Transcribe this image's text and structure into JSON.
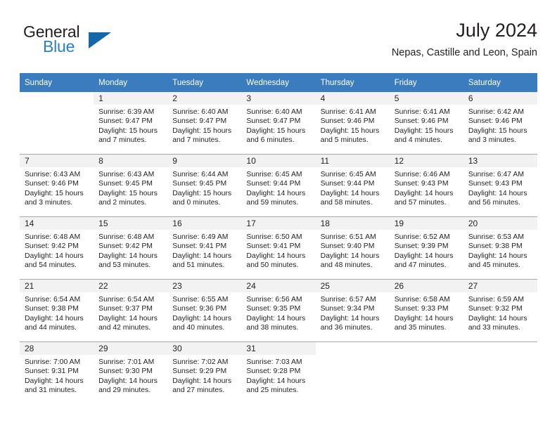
{
  "brand": {
    "name_part1": "General",
    "name_part2": "Blue",
    "triangle_color": "#1667a8",
    "blue_color": "#2980c4"
  },
  "header": {
    "title": "July 2024",
    "subtitle": "Nepas, Castille and Leon, Spain"
  },
  "theme": {
    "header_row_bg": "#3a7cbe",
    "header_row_text": "#ffffff",
    "daynum_bg": "#f2f2f2",
    "grid_line": "#a9a9a9",
    "text": "#231f20"
  },
  "weekdays": [
    "Sunday",
    "Monday",
    "Tuesday",
    "Wednesday",
    "Thursday",
    "Friday",
    "Saturday"
  ],
  "weeks": [
    [
      {
        "day": "",
        "sunrise": "",
        "sunset": "",
        "daylight1": "",
        "daylight2": ""
      },
      {
        "day": "1",
        "sunrise": "Sunrise: 6:39 AM",
        "sunset": "Sunset: 9:47 PM",
        "daylight1": "Daylight: 15 hours",
        "daylight2": "and 7 minutes."
      },
      {
        "day": "2",
        "sunrise": "Sunrise: 6:40 AM",
        "sunset": "Sunset: 9:47 PM",
        "daylight1": "Daylight: 15 hours",
        "daylight2": "and 7 minutes."
      },
      {
        "day": "3",
        "sunrise": "Sunrise: 6:40 AM",
        "sunset": "Sunset: 9:47 PM",
        "daylight1": "Daylight: 15 hours",
        "daylight2": "and 6 minutes."
      },
      {
        "day": "4",
        "sunrise": "Sunrise: 6:41 AM",
        "sunset": "Sunset: 9:46 PM",
        "daylight1": "Daylight: 15 hours",
        "daylight2": "and 5 minutes."
      },
      {
        "day": "5",
        "sunrise": "Sunrise: 6:41 AM",
        "sunset": "Sunset: 9:46 PM",
        "daylight1": "Daylight: 15 hours",
        "daylight2": "and 4 minutes."
      },
      {
        "day": "6",
        "sunrise": "Sunrise: 6:42 AM",
        "sunset": "Sunset: 9:46 PM",
        "daylight1": "Daylight: 15 hours",
        "daylight2": "and 3 minutes."
      }
    ],
    [
      {
        "day": "7",
        "sunrise": "Sunrise: 6:43 AM",
        "sunset": "Sunset: 9:46 PM",
        "daylight1": "Daylight: 15 hours",
        "daylight2": "and 3 minutes."
      },
      {
        "day": "8",
        "sunrise": "Sunrise: 6:43 AM",
        "sunset": "Sunset: 9:45 PM",
        "daylight1": "Daylight: 15 hours",
        "daylight2": "and 2 minutes."
      },
      {
        "day": "9",
        "sunrise": "Sunrise: 6:44 AM",
        "sunset": "Sunset: 9:45 PM",
        "daylight1": "Daylight: 15 hours",
        "daylight2": "and 0 minutes."
      },
      {
        "day": "10",
        "sunrise": "Sunrise: 6:45 AM",
        "sunset": "Sunset: 9:44 PM",
        "daylight1": "Daylight: 14 hours",
        "daylight2": "and 59 minutes."
      },
      {
        "day": "11",
        "sunrise": "Sunrise: 6:45 AM",
        "sunset": "Sunset: 9:44 PM",
        "daylight1": "Daylight: 14 hours",
        "daylight2": "and 58 minutes."
      },
      {
        "day": "12",
        "sunrise": "Sunrise: 6:46 AM",
        "sunset": "Sunset: 9:43 PM",
        "daylight1": "Daylight: 14 hours",
        "daylight2": "and 57 minutes."
      },
      {
        "day": "13",
        "sunrise": "Sunrise: 6:47 AM",
        "sunset": "Sunset: 9:43 PM",
        "daylight1": "Daylight: 14 hours",
        "daylight2": "and 56 minutes."
      }
    ],
    [
      {
        "day": "14",
        "sunrise": "Sunrise: 6:48 AM",
        "sunset": "Sunset: 9:42 PM",
        "daylight1": "Daylight: 14 hours",
        "daylight2": "and 54 minutes."
      },
      {
        "day": "15",
        "sunrise": "Sunrise: 6:48 AM",
        "sunset": "Sunset: 9:42 PM",
        "daylight1": "Daylight: 14 hours",
        "daylight2": "and 53 minutes."
      },
      {
        "day": "16",
        "sunrise": "Sunrise: 6:49 AM",
        "sunset": "Sunset: 9:41 PM",
        "daylight1": "Daylight: 14 hours",
        "daylight2": "and 51 minutes."
      },
      {
        "day": "17",
        "sunrise": "Sunrise: 6:50 AM",
        "sunset": "Sunset: 9:41 PM",
        "daylight1": "Daylight: 14 hours",
        "daylight2": "and 50 minutes."
      },
      {
        "day": "18",
        "sunrise": "Sunrise: 6:51 AM",
        "sunset": "Sunset: 9:40 PM",
        "daylight1": "Daylight: 14 hours",
        "daylight2": "and 48 minutes."
      },
      {
        "day": "19",
        "sunrise": "Sunrise: 6:52 AM",
        "sunset": "Sunset: 9:39 PM",
        "daylight1": "Daylight: 14 hours",
        "daylight2": "and 47 minutes."
      },
      {
        "day": "20",
        "sunrise": "Sunrise: 6:53 AM",
        "sunset": "Sunset: 9:38 PM",
        "daylight1": "Daylight: 14 hours",
        "daylight2": "and 45 minutes."
      }
    ],
    [
      {
        "day": "21",
        "sunrise": "Sunrise: 6:54 AM",
        "sunset": "Sunset: 9:38 PM",
        "daylight1": "Daylight: 14 hours",
        "daylight2": "and 44 minutes."
      },
      {
        "day": "22",
        "sunrise": "Sunrise: 6:54 AM",
        "sunset": "Sunset: 9:37 PM",
        "daylight1": "Daylight: 14 hours",
        "daylight2": "and 42 minutes."
      },
      {
        "day": "23",
        "sunrise": "Sunrise: 6:55 AM",
        "sunset": "Sunset: 9:36 PM",
        "daylight1": "Daylight: 14 hours",
        "daylight2": "and 40 minutes."
      },
      {
        "day": "24",
        "sunrise": "Sunrise: 6:56 AM",
        "sunset": "Sunset: 9:35 PM",
        "daylight1": "Daylight: 14 hours",
        "daylight2": "and 38 minutes."
      },
      {
        "day": "25",
        "sunrise": "Sunrise: 6:57 AM",
        "sunset": "Sunset: 9:34 PM",
        "daylight1": "Daylight: 14 hours",
        "daylight2": "and 36 minutes."
      },
      {
        "day": "26",
        "sunrise": "Sunrise: 6:58 AM",
        "sunset": "Sunset: 9:33 PM",
        "daylight1": "Daylight: 14 hours",
        "daylight2": "and 35 minutes."
      },
      {
        "day": "27",
        "sunrise": "Sunrise: 6:59 AM",
        "sunset": "Sunset: 9:32 PM",
        "daylight1": "Daylight: 14 hours",
        "daylight2": "and 33 minutes."
      }
    ],
    [
      {
        "day": "28",
        "sunrise": "Sunrise: 7:00 AM",
        "sunset": "Sunset: 9:31 PM",
        "daylight1": "Daylight: 14 hours",
        "daylight2": "and 31 minutes."
      },
      {
        "day": "29",
        "sunrise": "Sunrise: 7:01 AM",
        "sunset": "Sunset: 9:30 PM",
        "daylight1": "Daylight: 14 hours",
        "daylight2": "and 29 minutes."
      },
      {
        "day": "30",
        "sunrise": "Sunrise: 7:02 AM",
        "sunset": "Sunset: 9:29 PM",
        "daylight1": "Daylight: 14 hours",
        "daylight2": "and 27 minutes."
      },
      {
        "day": "31",
        "sunrise": "Sunrise: 7:03 AM",
        "sunset": "Sunset: 9:28 PM",
        "daylight1": "Daylight: 14 hours",
        "daylight2": "and 25 minutes."
      },
      {
        "day": "",
        "sunrise": "",
        "sunset": "",
        "daylight1": "",
        "daylight2": ""
      },
      {
        "day": "",
        "sunrise": "",
        "sunset": "",
        "daylight1": "",
        "daylight2": ""
      },
      {
        "day": "",
        "sunrise": "",
        "sunset": "",
        "daylight1": "",
        "daylight2": ""
      }
    ]
  ]
}
